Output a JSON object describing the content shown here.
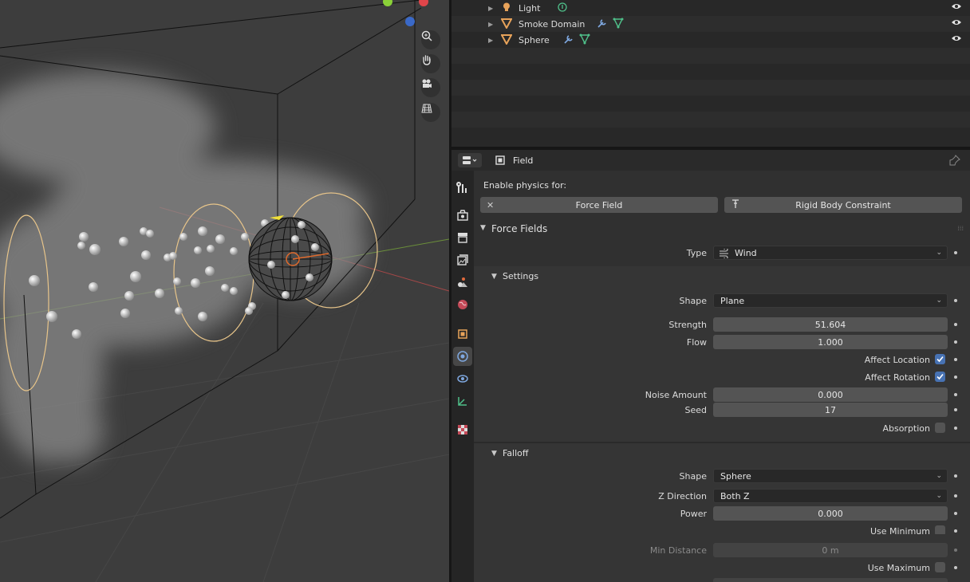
{
  "viewport": {
    "nav_buttons": [
      "zoom-icon",
      "hand-pan-icon",
      "camera-icon",
      "grid-ortho-icon"
    ]
  },
  "outliner": {
    "rows": [
      {
        "label": "Light",
        "icon": "light-bulb-icon",
        "mods": [
          "light-data-icon"
        ]
      },
      {
        "label": "Smoke Domain",
        "icon": "mesh-object-icon",
        "mods": [
          "wrench-modifier-icon",
          "mesh-data-icon"
        ]
      },
      {
        "label": "Sphere",
        "icon": "mesh-object-icon",
        "mods": [
          "wrench-modifier-icon",
          "mesh-data-icon"
        ]
      }
    ]
  },
  "properties": {
    "header": {
      "context": "Field"
    },
    "enable_label": "Enable physics for:",
    "force_field_btn": "Force Field",
    "rigid_btn": "Rigid Body Constraint",
    "force_fields_panel": "Force Fields",
    "type_label": "Type",
    "type_value": "Wind",
    "settings_panel": "Settings",
    "shape_label": "Shape",
    "shape_value": "Plane",
    "strength_label": "Strength",
    "strength_value": "51.604",
    "flow_label": "Flow",
    "flow_value": "1.000",
    "affect_location": "Affect Location",
    "affect_rotation": "Affect Rotation",
    "noise_label": "Noise Amount",
    "noise_value": "0.000",
    "seed_label": "Seed",
    "seed_value": "17",
    "absorption": "Absorption",
    "falloff_panel": "Falloff",
    "falloff_shape_label": "Shape",
    "falloff_shape_value": "Sphere",
    "zdir_label": "Z Direction",
    "zdir_value": "Both Z",
    "power_label": "Power",
    "power_value": "0.000",
    "use_min": "Use Minimum",
    "min_dist_label": "Min Distance",
    "min_dist_value": "0 m",
    "use_max": "Use Maximum",
    "checkboxes": {
      "affect_location": true,
      "affect_rotation": true,
      "absorption": false,
      "use_minimum": false,
      "use_maximum": false
    }
  },
  "colors": {
    "accent_checkbox": "#4772b3",
    "active_tab": "#474747"
  }
}
